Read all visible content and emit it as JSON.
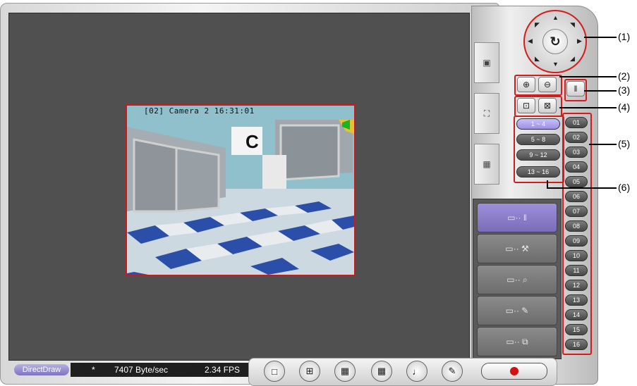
{
  "camera": {
    "caption": "[02] Camera 2 16:31:01",
    "sign_letter": "C"
  },
  "side_tabs": [
    {
      "icon": "video-window-icon"
    },
    {
      "icon": "fullscreen-icon"
    },
    {
      "icon": "snapshot-icon"
    }
  ],
  "ptz": {
    "center_icon": "↻"
  },
  "zoom": {
    "in_icon": "⊕",
    "out_icon": "⊖",
    "joystick_icon": "‖"
  },
  "focus": {
    "near_icon": "⊡",
    "far_icon": "⊠"
  },
  "groups": [
    "1 ~ 4",
    "5 ~ 8",
    "9 ~ 12",
    "13 ~ 16"
  ],
  "channels": [
    "01",
    "02",
    "03",
    "04",
    "05",
    "06",
    "07",
    "08",
    "09",
    "10",
    "11",
    "12",
    "13",
    "14",
    "15",
    "16"
  ],
  "functions": [
    {
      "icon": "monitor-to-joystick-icon",
      "glyph": "▭·· ‖"
    },
    {
      "icon": "monitor-to-tools-icon",
      "glyph": "▭·· ⚒"
    },
    {
      "icon": "monitor-to-search-icon",
      "glyph": "▭·· ⌕"
    },
    {
      "icon": "monitor-to-pen-icon",
      "glyph": "▭·· ✎"
    },
    {
      "icon": "monitor-to-copy-icon",
      "glyph": "▭·· ⧉"
    }
  ],
  "callouts": [
    "(1)",
    "(2)",
    "(3)",
    "(4)",
    "(5)",
    "(6)"
  ],
  "status": {
    "render_mode": "DirectDraw",
    "marker": "*",
    "byte_rate": "7407 Byte/sec",
    "fps": "2.34 FPS"
  },
  "bottom_controls": [
    {
      "icon": "single-view-icon",
      "glyph": "□"
    },
    {
      "icon": "quad-view-icon",
      "glyph": "⊞"
    },
    {
      "icon": "nine-view-icon",
      "glyph": "▦"
    },
    {
      "icon": "sixteen-view-icon",
      "glyph": "▦"
    },
    {
      "icon": "speaker-icon",
      "glyph": "♩"
    },
    {
      "icon": "pen-icon",
      "glyph": "✎"
    }
  ],
  "colors": {
    "highlight": "#d41c1c",
    "active_button": "#9d8fe0",
    "viewer_bg": "#505050"
  }
}
